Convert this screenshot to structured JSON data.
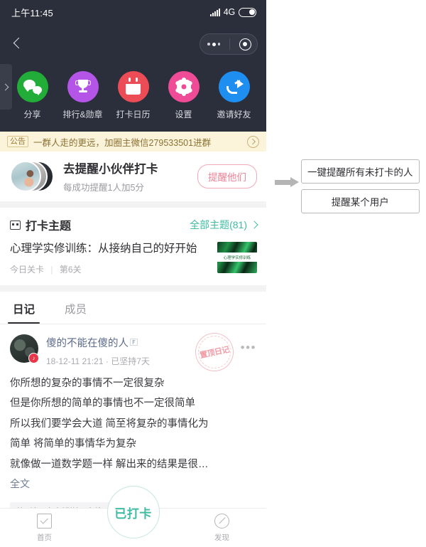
{
  "status_bar": {
    "time": "上午11:45",
    "network": "4G",
    "signal_icon": "signal-bars-icon",
    "battery_icon": "battery-icon"
  },
  "nav": {
    "back_icon": "back-chevron-icon",
    "capsule": {
      "more_icon": "more-dots-icon",
      "target_icon": "target-circle-icon"
    },
    "side_tab_icon": "expand-chevron-icon"
  },
  "quick_actions": [
    {
      "label": "分享",
      "icon": "wechat-icon",
      "color": "#22ac38"
    },
    {
      "label": "排行&勋章",
      "icon": "trophy-icon",
      "color": "#b455e8"
    },
    {
      "label": "打卡日历",
      "icon": "calendar-icon",
      "color": "#ec4c55"
    },
    {
      "label": "设置",
      "icon": "gear-icon",
      "color": "#ef4b96"
    },
    {
      "label": "邀请好友",
      "icon": "share-arrow-icon",
      "color": "#1f8ef1"
    }
  ],
  "announcement": {
    "tag": "公告",
    "text": "一群人走的更远，加圈主微信279533501进群",
    "chevron_icon": "chevron-right-circle-icon"
  },
  "reminder_card": {
    "title": "去提醒小伙伴打卡",
    "subtitle": "每成功提醒1人加5分",
    "button_label": "提醒他们",
    "button_color": "#ef8296",
    "avatar_icon": "avatar-stack"
  },
  "theme_section": {
    "icon": "theme-board-icon",
    "title": "打卡主题",
    "more_label": "全部主题(81)",
    "more_chevron_icon": "chevron-right-icon",
    "accent_color": "#3fbca2",
    "item": {
      "title": "心理学实修训练：从接纳自己的好开始",
      "meta_left": "今日关卡",
      "meta_sep": "|",
      "meta_right": "第6关",
      "thumb_text": "心理学实修训练"
    }
  },
  "tabs": [
    {
      "label": "日记",
      "active": true
    },
    {
      "label": "成员",
      "active": false
    }
  ],
  "post": {
    "author": "傻的不能在傻的人",
    "author_suffix": "🄵",
    "avatar_badge": "♪",
    "time": "18-12-11 21:21",
    "time_sep": "·",
    "streak": "已坚持7天",
    "stamp_text": "置顶日记",
    "more_icon": "more-dots-icon",
    "lines": [
      "你所想的复杂的事情不一定很复杂",
      "但是你所想的简单的事情也不一定很简单",
      "所以我们要学会大道 简至将复杂的事情化为",
      "简单 将简单的事情华为复杂",
      "就像做一道数学题一样 解出来的结果是很…"
    ],
    "full_label": "全文",
    "tag": "第7关：奥卡姆剃刀定律：大道至简"
  },
  "bottom_nav": {
    "items": [
      {
        "label": "首页",
        "icon": "home-check-icon"
      },
      {
        "label": "发现",
        "icon": "compass-icon"
      }
    ],
    "checkin_label": "已打卡",
    "checkin_color": "#3fbca2"
  },
  "annotation": {
    "arrow_icon": "right-arrow-icon",
    "callouts": [
      "一键提醒所有未打卡的人",
      "提醒某个用户"
    ]
  }
}
